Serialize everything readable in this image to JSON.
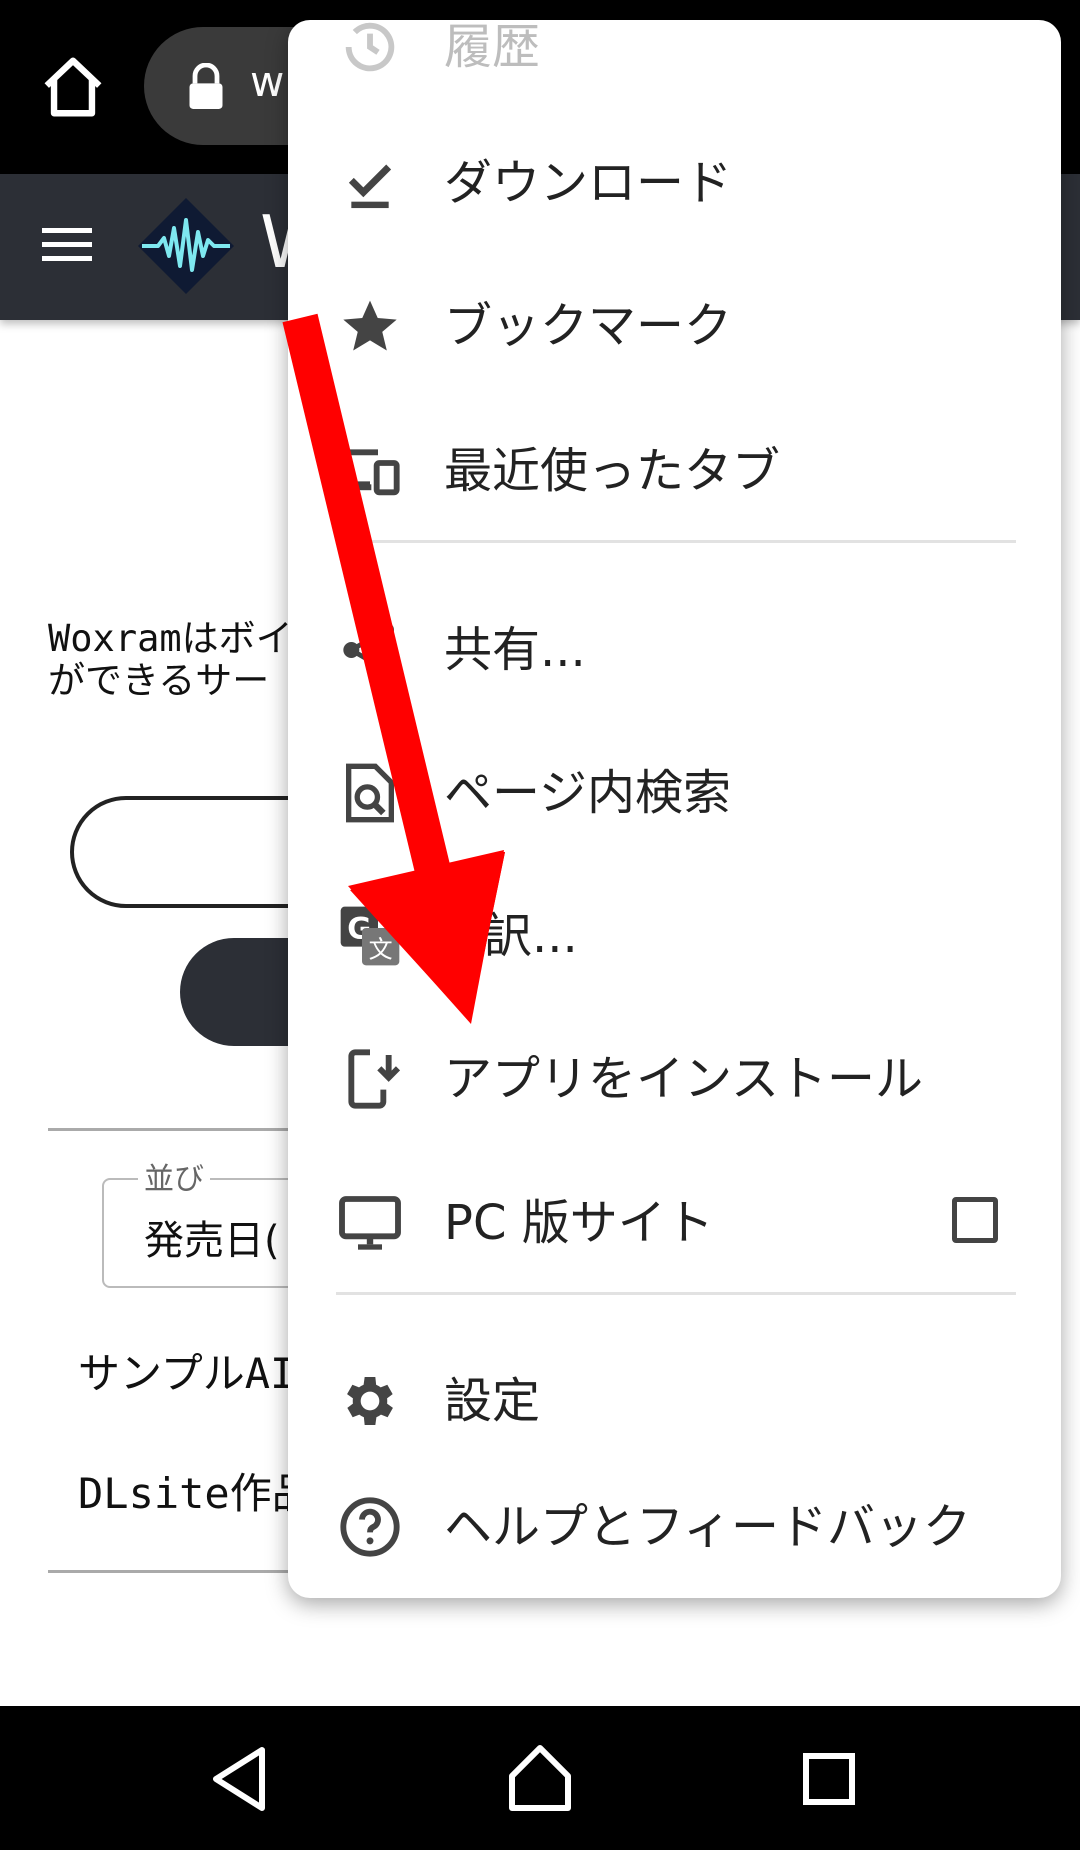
{
  "browser": {
    "url_visible": "w"
  },
  "site": {
    "title": "W",
    "intro_line1": "Woxramはボイ",
    "intro_line2": "ができるサー",
    "sort_label": "並び",
    "sort_value": "発売日(",
    "items": [
      "サンプルAI",
      "DLsite作品"
    ]
  },
  "menu": {
    "history_partial": "履歴",
    "downloads": "ダウンロード",
    "bookmarks": "ブックマーク",
    "recent_tabs": "最近使ったタブ",
    "share": "共有...",
    "find_in_page": "ページ内検索",
    "translate": "訳...",
    "install_app": "アプリをインストール",
    "desktop_site": "PC 版サイト",
    "settings": "設定",
    "help_feedback": "ヘルプとフィードバック"
  },
  "colors": {
    "annotation_arrow": "#ff0000",
    "header_bg": "#2c2f36",
    "logo_wave": "#7ee8f0"
  },
  "icons": {
    "history": "history-icon",
    "downloads": "check-download-icon",
    "bookmarks": "star-icon",
    "recent_tabs": "devices-icon",
    "share": "share-icon",
    "find_in_page": "find-in-page-icon",
    "translate": "google-translate-icon",
    "install_app": "install-mobile-icon",
    "desktop_site": "desktop-monitor-icon",
    "settings": "gear-icon",
    "help": "help-circle-icon"
  }
}
